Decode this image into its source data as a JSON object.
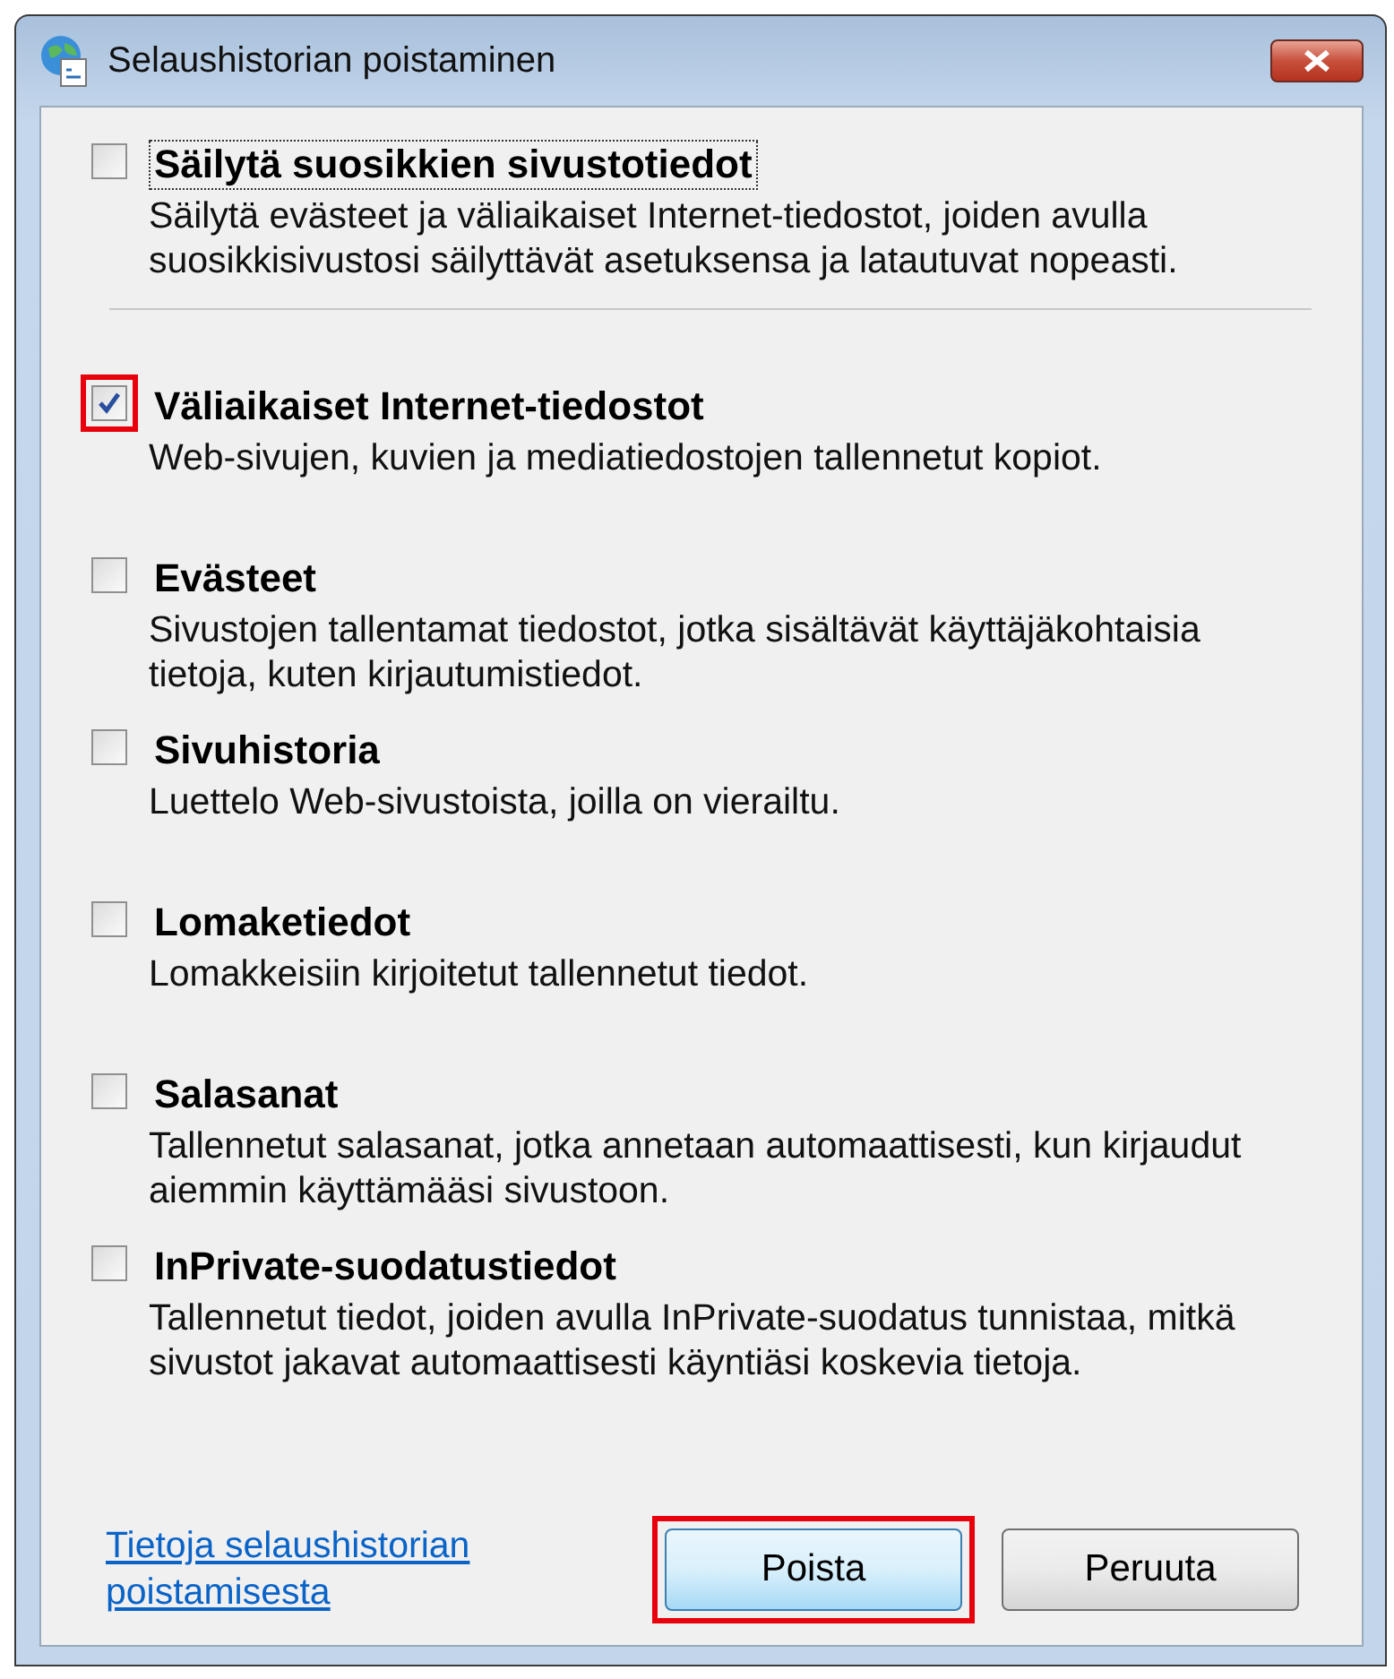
{
  "window": {
    "title": "Selaushistorian poistaminen"
  },
  "options": [
    {
      "label": "Säilytä suosikkien sivustotiedot",
      "description": "Säilytä evästeet ja väliaikaiset Internet-tiedostot, joiden avulla suosikkisivustosi säilyttävät asetuksensa ja latautuvat nopeasti.",
      "checked": false,
      "focused": true,
      "highlighted": false,
      "divider_after": true
    },
    {
      "label": "Väliaikaiset Internet-tiedostot",
      "description": "Web-sivujen, kuvien ja mediatiedostojen tallennetut kopiot.",
      "checked": true,
      "focused": false,
      "highlighted": true,
      "divider_after": false
    },
    {
      "label": "Evästeet",
      "description": "Sivustojen tallentamat tiedostot, jotka sisältävät käyttäjäkohtaisia tietoja, kuten kirjautumistiedot.",
      "checked": false,
      "focused": false,
      "highlighted": false,
      "divider_after": false
    },
    {
      "label": "Sivuhistoria",
      "description": "Luettelo Web-sivustoista, joilla on vierailtu.",
      "checked": false,
      "focused": false,
      "highlighted": false,
      "divider_after": false
    },
    {
      "label": "Lomaketiedot",
      "description": "Lomakkeisiin kirjoitetut tallennetut tiedot.",
      "checked": false,
      "focused": false,
      "highlighted": false,
      "divider_after": false
    },
    {
      "label": "Salasanat",
      "description": "Tallennetut salasanat, jotka annetaan automaattisesti, kun kirjaudut aiemmin käyttämääsi sivustoon.",
      "checked": false,
      "focused": false,
      "highlighted": false,
      "divider_after": false
    },
    {
      "label": "InPrivate-suodatustiedot",
      "description": "Tallennetut tiedot, joiden avulla InPrivate-suodatus tunnistaa, mitkä sivustot jakavat automaattisesti käyntiäsi koskevia tietoja.",
      "checked": false,
      "focused": false,
      "highlighted": false,
      "divider_after": false
    }
  ],
  "footer": {
    "link": "Tietoja selaushistorian poistamisesta",
    "buttons": [
      {
        "label": "Poista",
        "default": true,
        "highlighted": true
      },
      {
        "label": "Peruuta",
        "default": false,
        "highlighted": false
      }
    ]
  }
}
